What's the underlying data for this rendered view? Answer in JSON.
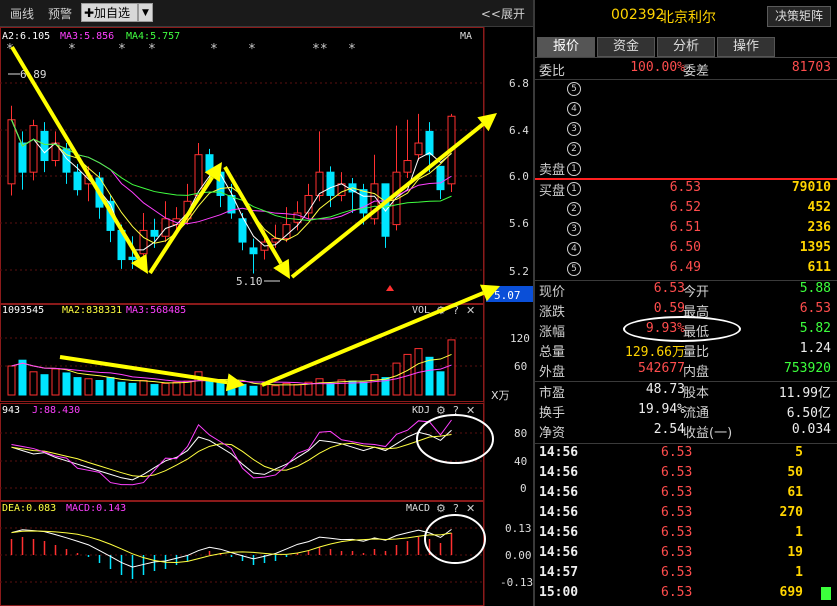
{
  "toolbar": {
    "line_label": "画线",
    "alert_label": "预警",
    "add_watch_label": "✚加自选",
    "expand_label": "<<展开"
  },
  "chart": {
    "ma_legend": [
      "A2:6.105",
      "MA3:5.856",
      "MA4:5.757"
    ],
    "ma_tag": "MA",
    "high_marker": "6.89",
    "low_marker": "5.10",
    "price_ticks": [
      "6.8",
      "6.4",
      "6.0",
      "5.6",
      "5.2"
    ],
    "current_price_tag": "5.07",
    "vol_legend": [
      "1093545",
      "MA2:838331",
      "MA3:568485"
    ],
    "vol_tag": "VOL",
    "vol_ticks": [
      "120",
      "60"
    ],
    "vol_unit": "X万",
    "kdj_legend": [
      "943",
      "J:88.430"
    ],
    "kdj_tag": "KDJ",
    "kdj_ticks": [
      "80",
      "40",
      "0"
    ],
    "macd_legend": [
      "DEA:0.083",
      "MACD:0.143"
    ],
    "macd_tag": "MACD",
    "macd_ticks": [
      "0.13",
      "0.00",
      "-0.13"
    ],
    "panel_ctrl": [
      "⚙",
      "?",
      "✕"
    ],
    "stars": [
      "*",
      "*",
      "*",
      "*",
      "*",
      "*",
      "**",
      "*"
    ],
    "candle_up_color": "#ff3030",
    "candle_down_color": "#00e5ff",
    "arrow_color": "#ffff00"
  },
  "quote": {
    "code": "002392",
    "name": "北京利尔",
    "decision_label": "决策矩阵",
    "tabs": [
      "报价",
      "资金",
      "分析",
      "操作"
    ],
    "weibi_label": "委比",
    "weibi_value": "100.00%",
    "weicha_label": "委差",
    "weicha_value": "81703",
    "sell_label": "卖盘",
    "buy_label": "买盘",
    "sell_levels": [
      "5",
      "4",
      "3",
      "2",
      "1"
    ],
    "buy_levels": [
      {
        "n": "1",
        "price": "6.53",
        "vol": "79010"
      },
      {
        "n": "2",
        "price": "6.52",
        "vol": "452"
      },
      {
        "n": "3",
        "price": "6.51",
        "vol": "236"
      },
      {
        "n": "4",
        "price": "6.50",
        "vol": "1395"
      },
      {
        "n": "5",
        "price": "6.49",
        "vol": "611"
      }
    ],
    "stats": [
      {
        "l1": "现价",
        "v1": "6.53",
        "c1": "red",
        "l2": "今开",
        "v2": "5.88",
        "c2": "green"
      },
      {
        "l1": "涨跌",
        "v1": "0.59",
        "c1": "red",
        "l2": "最高",
        "v2": "6.53",
        "c2": "red"
      },
      {
        "l1": "涨幅",
        "v1": "9.93%",
        "c1": "red",
        "l2": "最低",
        "v2": "5.82",
        "c2": "green"
      },
      {
        "l1": "总量",
        "v1": "129.66万",
        "c1": "yellow",
        "l2": "量比",
        "v2": "1.24",
        "c2": "white"
      },
      {
        "l1": "外盘",
        "v1": "542677",
        "c1": "red",
        "l2": "内盘",
        "v2": "753920",
        "c2": "green"
      }
    ],
    "stats2": [
      {
        "l1": "市盈",
        "v1": "48.73",
        "l2": "股本",
        "v2": "11.99亿"
      },
      {
        "l1": "换手",
        "v1": "19.94%",
        "l2": "流通",
        "v2": "6.50亿"
      },
      {
        "l1": "净资",
        "v1": "2.54",
        "l2": "收益(一)",
        "v2": "0.034"
      }
    ],
    "trades": [
      {
        "time": "14:56",
        "price": "6.53",
        "vol": "5"
      },
      {
        "time": "14:56",
        "price": "6.53",
        "vol": "50"
      },
      {
        "time": "14:56",
        "price": "6.53",
        "vol": "61"
      },
      {
        "time": "14:56",
        "price": "6.53",
        "vol": "270"
      },
      {
        "time": "14:56",
        "price": "6.53",
        "vol": "1"
      },
      {
        "time": "14:56",
        "price": "6.53",
        "vol": "19"
      },
      {
        "time": "14:57",
        "price": "6.53",
        "vol": "1"
      },
      {
        "time": "15:00",
        "price": "6.53",
        "vol": "699"
      }
    ]
  }
}
